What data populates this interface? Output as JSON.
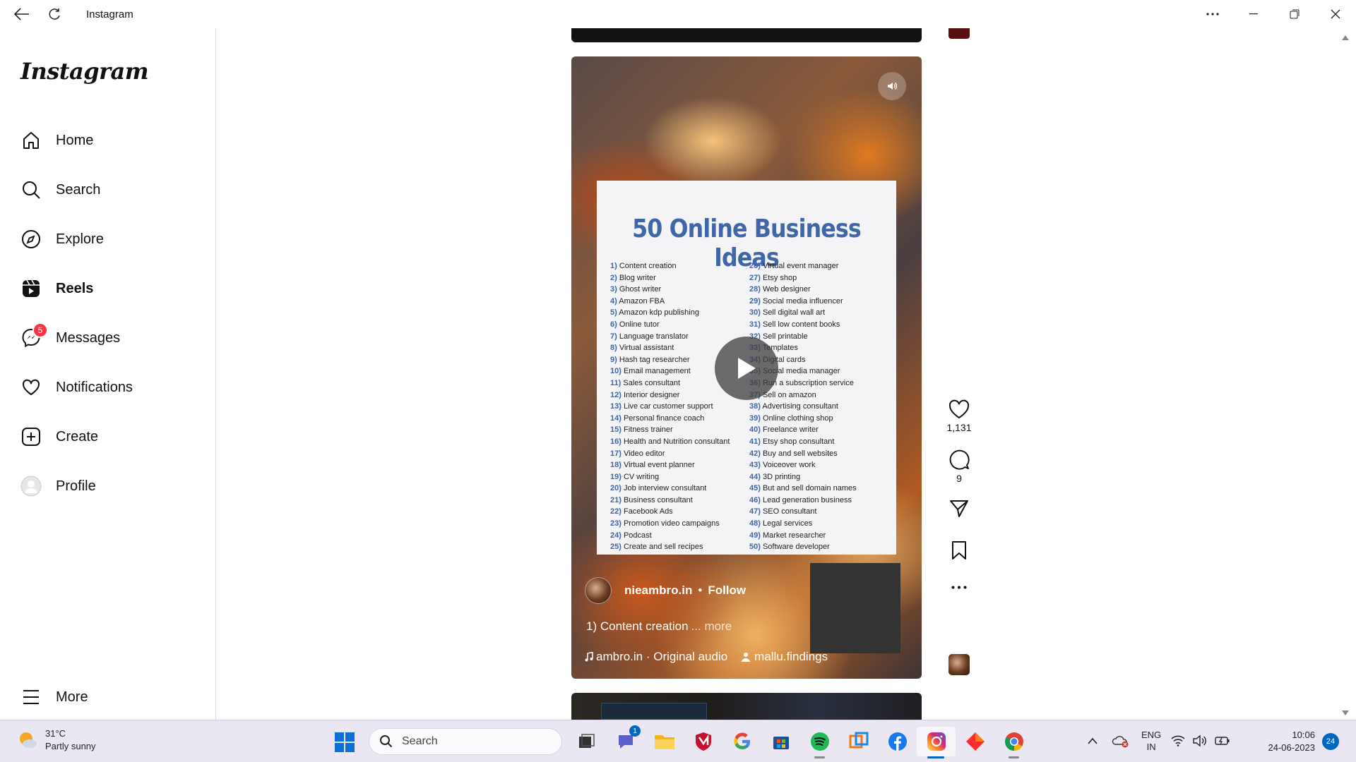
{
  "window": {
    "title": "Instagram"
  },
  "sidebar": {
    "logo": "Instagram",
    "items": [
      {
        "label": "Home",
        "icon": "home-icon"
      },
      {
        "label": "Search",
        "icon": "search-icon"
      },
      {
        "label": "Explore",
        "icon": "compass-icon"
      },
      {
        "label": "Reels",
        "icon": "reels-icon",
        "active": true
      },
      {
        "label": "Messages",
        "icon": "messenger-icon",
        "badge": "5"
      },
      {
        "label": "Notifications",
        "icon": "heart-icon"
      },
      {
        "label": "Create",
        "icon": "plus-square-icon"
      },
      {
        "label": "Profile",
        "icon": "avatar-icon"
      }
    ],
    "more": "More"
  },
  "reel": {
    "poster_title": "50 Online Business Ideas",
    "ideas_left": [
      {
        "n": "1)",
        "t": "Content creation"
      },
      {
        "n": "2)",
        "t": "Blog writer"
      },
      {
        "n": "3)",
        "t": "Ghost writer"
      },
      {
        "n": "4)",
        "t": "Amazon FBA"
      },
      {
        "n": "5)",
        "t": "Amazon kdp publishing"
      },
      {
        "n": "6)",
        "t": "Online tutor"
      },
      {
        "n": "7)",
        "t": "Language translator"
      },
      {
        "n": "8)",
        "t": "Virtual assistant"
      },
      {
        "n": "9)",
        "t": "Hash tag researcher"
      },
      {
        "n": "10)",
        "t": "Email management"
      },
      {
        "n": "11)",
        "t": "Sales consultant"
      },
      {
        "n": "12)",
        "t": "Interior designer"
      },
      {
        "n": "13)",
        "t": "Live car customer support"
      },
      {
        "n": "14)",
        "t": "Personal finance coach"
      },
      {
        "n": "15)",
        "t": "Fitness trainer"
      },
      {
        "n": "16)",
        "t": "Health and Nutrition consultant"
      },
      {
        "n": "17)",
        "t": "Video editor"
      },
      {
        "n": "18)",
        "t": "Virtual event planner"
      },
      {
        "n": "19)",
        "t": "CV writing"
      },
      {
        "n": "20)",
        "t": "Job interview consultant"
      },
      {
        "n": "21)",
        "t": "Business consultant"
      },
      {
        "n": "22)",
        "t": "Facebook Ads"
      },
      {
        "n": "23)",
        "t": "Promotion video campaigns"
      },
      {
        "n": "24)",
        "t": "Podcast"
      },
      {
        "n": "25)",
        "t": "Create and sell recipes"
      }
    ],
    "ideas_right": [
      {
        "n": "26)",
        "t": "Virtual event manager"
      },
      {
        "n": "27)",
        "t": "Etsy shop"
      },
      {
        "n": "28)",
        "t": "Web designer"
      },
      {
        "n": "29)",
        "t": "Social media influencer"
      },
      {
        "n": "30)",
        "t": "Sell digital wall art"
      },
      {
        "n": "31)",
        "t": "Sell low content books"
      },
      {
        "n": "32)",
        "t": "Sell printable"
      },
      {
        "n": "33)",
        "t": "Templates"
      },
      {
        "n": "34)",
        "t": "Digital cards"
      },
      {
        "n": "35)",
        "t": "Social media manager"
      },
      {
        "n": "36)",
        "t": "Run a subscription service"
      },
      {
        "n": "37)",
        "t": "Sell on amazon"
      },
      {
        "n": "38)",
        "t": "Advertising consultant"
      },
      {
        "n": "39)",
        "t": "Online clothing shop"
      },
      {
        "n": "40)",
        "t": "Freelance writer"
      },
      {
        "n": "41)",
        "t": "Etsy shop consultant"
      },
      {
        "n": "42)",
        "t": "Buy and sell websites"
      },
      {
        "n": "43)",
        "t": "Voiceover work"
      },
      {
        "n": "44)",
        "t": "3D printing"
      },
      {
        "n": "45)",
        "t": "But and sell domain names"
      },
      {
        "n": "46)",
        "t": "Lead generation business"
      },
      {
        "n": "47)",
        "t": "SEO consultant"
      },
      {
        "n": "48)",
        "t": "Legal services"
      },
      {
        "n": "49)",
        "t": "Market researcher"
      },
      {
        "n": "50)",
        "t": "Software developer"
      }
    ],
    "owner": "nieambro.in",
    "separator": "•",
    "follow": "Follow",
    "caption": "1) Content creation",
    "caption_more": "... more",
    "audio": "ambro.in · Original audio",
    "tagged_user": "mallu.findings"
  },
  "actions": {
    "likes": "1,131",
    "comments": "9"
  },
  "taskbar": {
    "weather_temp": "31°C",
    "weather_desc": "Partly sunny",
    "search_placeholder": "Search",
    "chat_badge": "1",
    "lang_top": "ENG",
    "lang_bottom": "IN",
    "time": "10:06",
    "date": "24-06-2023",
    "notifications": "24"
  },
  "colors": {
    "accent": "#0067c0",
    "poster_blue": "#3f67a8",
    "badge_red": "#ff3040"
  }
}
